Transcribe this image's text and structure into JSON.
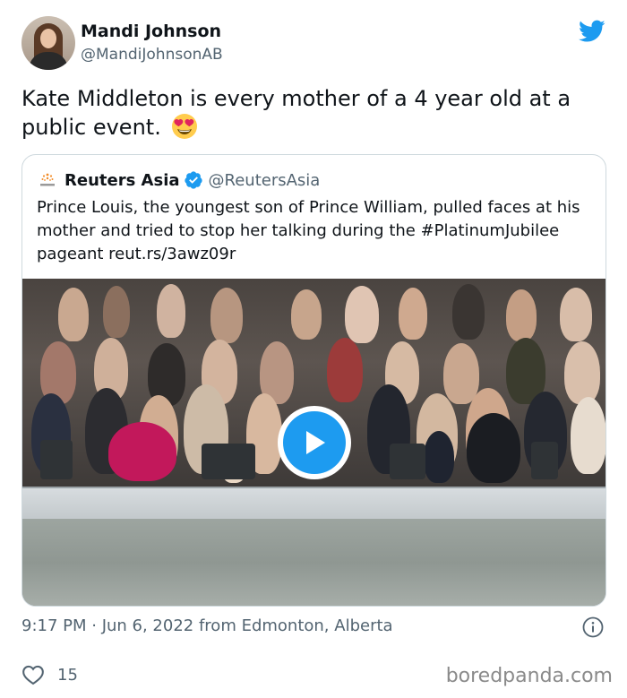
{
  "tweet": {
    "author_name": "Mandi Johnson",
    "author_handle": "@MandiJohnsonAB",
    "text": "Kate Middleton is every mother of a 4 year old at a public event.",
    "emoji": "smiling-face-with-heart-eyes",
    "timestamp": "9:17 PM · Jun 6, 2022 from Edmonton, Alberta",
    "likes": "15"
  },
  "quoted": {
    "author_name": "Reuters Asia",
    "author_handle": "@ReutersAsia",
    "text": "Prince Louis, the youngest son of Prince William, pulled faces at his mother and tried to stop her talking during the #PlatinumJubilee pageant reut.rs/3awz09r",
    "media": "video-thumbnail"
  },
  "watermark": "boredpanda.com",
  "colors": {
    "twitter_blue": "#1d9bf0",
    "secondary_text": "#536471",
    "border": "#cfd9de"
  }
}
